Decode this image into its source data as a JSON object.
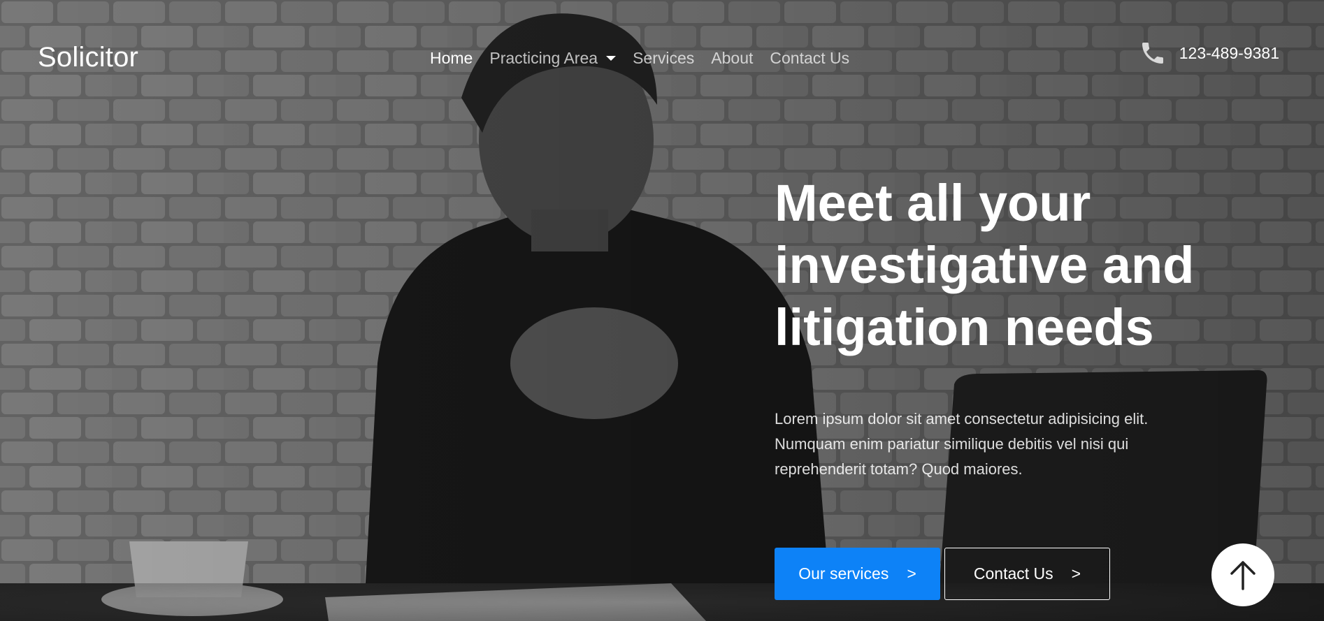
{
  "brand": {
    "name": "Solicitor"
  },
  "nav": {
    "items": [
      {
        "label": "Home"
      },
      {
        "label": "Practicing Area"
      },
      {
        "label": "Services"
      },
      {
        "label": "About"
      },
      {
        "label": "Contact Us"
      }
    ]
  },
  "contact": {
    "phone": "123-489-9381",
    "icon": "phone-icon"
  },
  "hero": {
    "title": "Meet all your investigative and litigation needs",
    "text": "Lorem ipsum dolor sit amet consectetur adipisicing elit. Numquam enim pariatur similique debitis vel nisi qui reprehenderit totam? Quod maiores.",
    "primary_button": {
      "label": "Our services",
      "arrow": ">"
    },
    "secondary_button": {
      "label": "Contact Us",
      "arrow": ">"
    }
  },
  "back_to_top": {
    "icon": "arrow-up-icon"
  },
  "colors": {
    "primary": "#0d82f7",
    "text": "#ffffff"
  }
}
